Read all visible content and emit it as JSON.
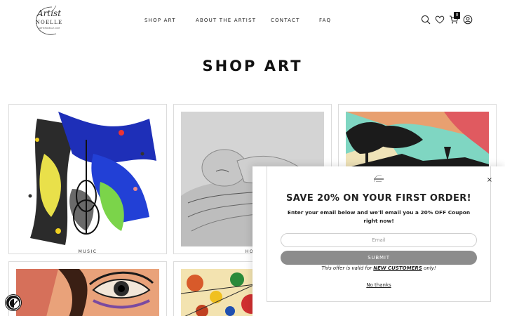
{
  "header": {
    "logo": {
      "script": "Artist",
      "name": "NOELLE",
      "url": "ARTISTNOELLE.COM"
    },
    "nav": [
      {
        "label": "SHOP ART"
      },
      {
        "label": "ABOUT THE ARTIST"
      },
      {
        "label": "CONTACT"
      },
      {
        "label": "FAQ"
      }
    ],
    "icons": [
      "search-icon",
      "heart-icon",
      "cart-icon",
      "account-icon"
    ],
    "cart_count": "0"
  },
  "page": {
    "title": "SHOP ART"
  },
  "products": [
    {
      "label": "MUSIC"
    },
    {
      "label": "HOLI"
    },
    {
      "label": ""
    },
    {
      "label": ""
    },
    {
      "label": ""
    }
  ],
  "popup": {
    "title": "SAVE 20% ON YOUR FIRST ORDER!",
    "subtitle": "Enter your email below and we'll email you a 20% OFF Coupon right now!",
    "email_placeholder": "Email",
    "submit_label": "SUBMIT",
    "offer_prefix": "This offer is valid for ",
    "offer_strong": "NEW CUSTOMERS",
    "offer_suffix": " only!",
    "no_thanks": "No thanks",
    "close_label": "×"
  },
  "accessibility": {
    "icon": "accessibility-icon"
  },
  "colors": {
    "accent": "#111111",
    "submit_bg": "#8c8c8c",
    "border": "#dcdcdc"
  }
}
